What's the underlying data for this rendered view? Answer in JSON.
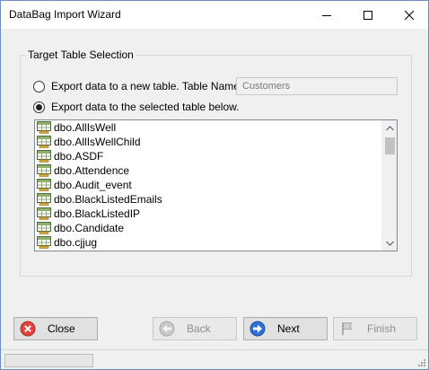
{
  "window": {
    "title": "DataBag Import Wizard"
  },
  "group": {
    "legend": "Target Table Selection"
  },
  "options": {
    "new_table_label": "Export data to a new table. Table Name:",
    "new_table_selected": false,
    "existing_table_label": "Export data to the selected table below.",
    "existing_table_selected": true,
    "table_name_value": "Customers"
  },
  "tables": {
    "items": [
      "dbo.AllIsWell",
      "dbo.AllIsWellChild",
      "dbo.ASDF",
      "dbo.Attendence",
      "dbo.Audit_event",
      "dbo.BlackListedEmails",
      "dbo.BlackListedIP",
      "dbo.Candidate",
      "dbo.cjjug"
    ]
  },
  "buttons": {
    "close": "Close",
    "back": "Back",
    "next": "Next",
    "finish": "Finish"
  },
  "icons": {
    "table": "table-icon",
    "close": "close-circle-icon",
    "back": "back-arrow-icon",
    "next": "next-arrow-icon",
    "finish": "finish-flag-icon"
  },
  "colors": {
    "close_icon": "#e0443e",
    "next_icon": "#2f6fd8",
    "disabled_text": "#8d8d8d"
  }
}
